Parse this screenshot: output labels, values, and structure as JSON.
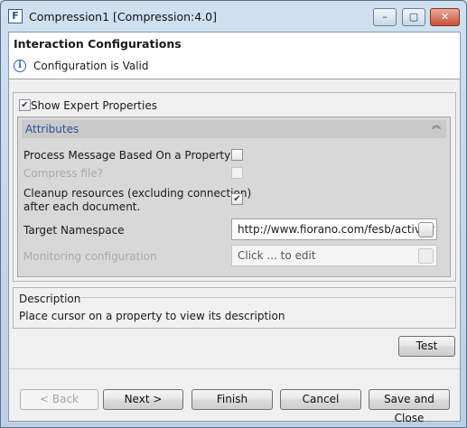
{
  "window": {
    "title": "Compression1 [Compression:4.0]",
    "app_icon_letter": "F",
    "minimize_symbol": "–",
    "maximize_symbol": "▢",
    "close_symbol": "✕"
  },
  "header": {
    "title": "Interaction Configurations",
    "status_icon": "info-icon",
    "status": "Configuration is Valid"
  },
  "expert": {
    "label": "Show Expert Properties",
    "checked": true
  },
  "attributes": {
    "title": "Attributes",
    "rows": [
      {
        "label": "Process Message Based On a Property",
        "type": "checkbox",
        "checked": false,
        "enabled": true
      },
      {
        "label": "Compress file?",
        "type": "checkbox",
        "checked": false,
        "enabled": false
      },
      {
        "label_line1": "Cleanup resources (excluding connection)",
        "label_line2": "after each document.",
        "type": "checkbox",
        "checked": true,
        "enabled": true
      },
      {
        "label": "Target Namespace",
        "type": "text",
        "value": "http://www.fiorano.com/fesb/activity",
        "enabled": true
      },
      {
        "label": "Monitoring configuration",
        "type": "text",
        "value": "Click ... to edit",
        "enabled": false
      }
    ]
  },
  "description": {
    "title": "Description",
    "text": "Place cursor on a property to view its description"
  },
  "buttons": {
    "test": "Test",
    "back": "< Back",
    "next": "Next >",
    "finish": "Finish",
    "cancel": "Cancel",
    "save_close": "Save and Close"
  },
  "colors": {
    "link_blue": "#2a4f9c",
    "title_bar": "#bcd0e5",
    "close_red": "#c8523a"
  }
}
